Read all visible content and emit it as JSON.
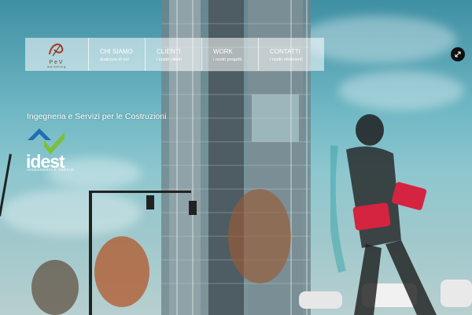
{
  "nav": {
    "logo": {
      "name": "PeV",
      "sub": "marketing"
    },
    "items": [
      {
        "title": "CHI SIAMO",
        "subtitle": "qualcosa di noi"
      },
      {
        "title": "CLIENTI",
        "subtitle": "i nostri clienti"
      },
      {
        "title": "WORK",
        "subtitle": "i nostri progetti"
      },
      {
        "title": "CONTATTI",
        "subtitle": "i nostri riferimenti"
      }
    ]
  },
  "hero": {
    "tagline": "Ingegneria e Servizi per le Costruzioni",
    "brand": {
      "word": "idest",
      "sub": "INGEGNERIA E SERVIZI"
    }
  },
  "colors": {
    "accent_blue": "#1f6fb5",
    "accent_green": "#7cbf3a",
    "sky": "#6fb7c4"
  },
  "icons": {
    "corner_button": "expand-icon"
  }
}
